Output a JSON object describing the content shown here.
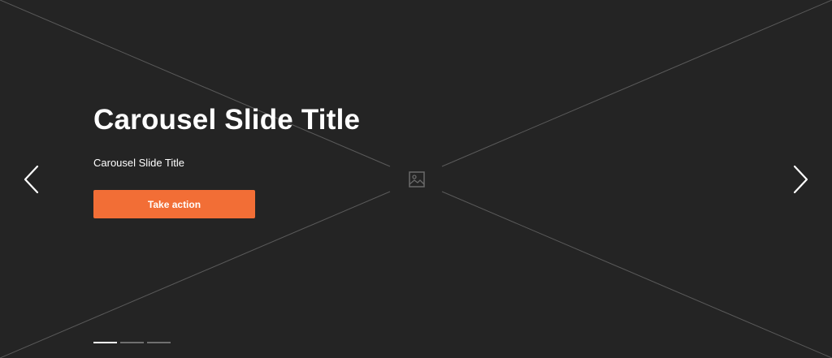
{
  "slide": {
    "title": "Carousel Slide Title",
    "subtitle": "Carousel Slide Title",
    "cta_label": "Take action"
  },
  "navigation": {
    "prev_icon": "chevron-left-icon",
    "next_icon": "chevron-right-icon"
  },
  "placeholder": {
    "icon": "image-icon"
  },
  "indicators": {
    "count": 3,
    "active_index": 0
  },
  "colors": {
    "background": "#242424",
    "accent": "#f26e36",
    "text": "#ffffff",
    "indicator_inactive": "#6f6f6f"
  }
}
